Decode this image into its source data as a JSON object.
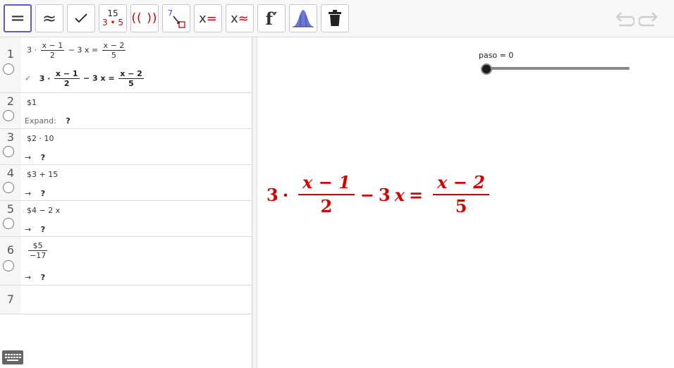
{
  "toolbar": {
    "eq_label": "=",
    "approx_label": "≈",
    "factor_top": "15",
    "factor_bottom": "3 • 5",
    "expand_label": "(( ))",
    "sub_label": "7",
    "solve_x": "x",
    "solve_eq": "=",
    "nsolve_x": "x",
    "nsolve_approx": "≈",
    "deriv_label": "f′"
  },
  "algebra": {
    "rows": [
      {
        "num": "1"
      },
      {
        "num": "2",
        "input": "$1",
        "output_label": "Expand:",
        "output": "?"
      },
      {
        "num": "3",
        "input": "$2 · 10",
        "arrow": "→",
        "output": "?"
      },
      {
        "num": "4",
        "input": "$3 + 15",
        "arrow": "→",
        "output": "?"
      },
      {
        "num": "5",
        "input": "$4 − 2 x",
        "arrow": "→",
        "output": "?"
      },
      {
        "num": "6",
        "input_num": "$5",
        "input_den": "−17",
        "arrow": "→",
        "output": "?"
      },
      {
        "num": "7"
      }
    ],
    "row1": {
      "input_a": "3 ·",
      "input_frac1_num": "x − 1",
      "input_frac1_den": "2",
      "input_b": "− 3 x =",
      "input_frac2_num": "x − 2",
      "input_frac2_den": "5",
      "check": "✓",
      "output_a": "3 ·",
      "output_frac1_num": "x − 1",
      "output_frac1_den": "2",
      "output_b": "− 3 x =",
      "output_frac2_num": "x − 2",
      "output_frac2_den": "5"
    }
  },
  "graphics": {
    "slider_label": "paso = 0",
    "slider_value": 0,
    "equation": {
      "coef": "3",
      "dot": "·",
      "frac1_num": "x − 1",
      "frac1_den": "2",
      "minus": "−",
      "term": "3",
      "term_var": "x",
      "equals": "=",
      "frac2_num": "x − 2",
      "frac2_den": "5"
    }
  },
  "colors": {
    "accent": "#6557d2",
    "red": "#d50000"
  },
  "icons": [
    "check-icon",
    "substitute-icon",
    "probability-icon",
    "delete-icon",
    "undo-icon",
    "redo-icon",
    "keyboard-icon"
  ]
}
